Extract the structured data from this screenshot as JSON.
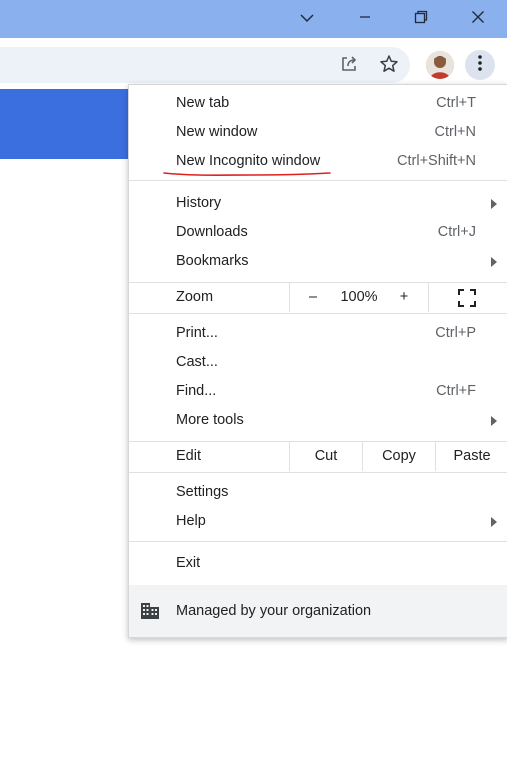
{
  "window_controls": {
    "chevron": "chevron-down-icon",
    "minimize": "minimize-icon",
    "restore": "restore-icon",
    "close": "close-icon"
  },
  "toolbar": {
    "share_icon": "share-icon",
    "bookmark_icon": "star-icon",
    "profile_icon": "avatar",
    "menu_icon": "kebab-menu-icon"
  },
  "menu": {
    "new_tab": {
      "label": "New tab",
      "shortcut": "Ctrl+T"
    },
    "new_window": {
      "label": "New window",
      "shortcut": "Ctrl+N"
    },
    "new_incognito": {
      "label": "New Incognito window",
      "shortcut": "Ctrl+Shift+N"
    },
    "history": {
      "label": "History"
    },
    "downloads": {
      "label": "Downloads",
      "shortcut": "Ctrl+J"
    },
    "bookmarks": {
      "label": "Bookmarks"
    },
    "zoom": {
      "label": "Zoom",
      "minus": "–",
      "value": "100%",
      "plus": "+"
    },
    "print": {
      "label": "Print...",
      "shortcut": "Ctrl+P"
    },
    "cast": {
      "label": "Cast..."
    },
    "find": {
      "label": "Find...",
      "shortcut": "Ctrl+F"
    },
    "more_tools": {
      "label": "More tools"
    },
    "edit": {
      "label": "Edit",
      "cut": "Cut",
      "copy": "Copy",
      "paste": "Paste"
    },
    "settings": {
      "label": "Settings"
    },
    "help": {
      "label": "Help"
    },
    "exit": {
      "label": "Exit"
    },
    "managed": {
      "label": "Managed by your organization"
    }
  },
  "colors": {
    "titlebar": "#8bb0ee",
    "annotation": "#e02020",
    "accent_bar": "#3b6fe0"
  }
}
